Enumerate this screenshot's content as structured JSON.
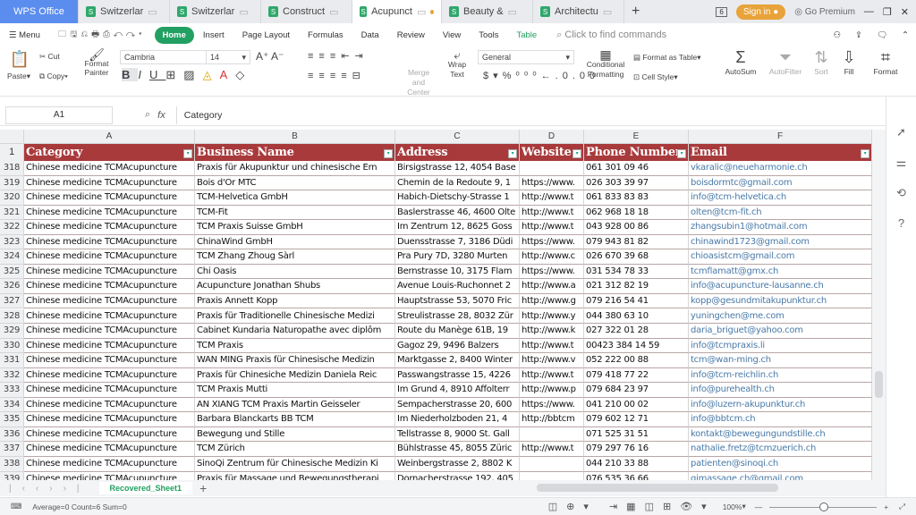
{
  "window": {
    "app": "WPS Office",
    "tabs": [
      "Switzerlar",
      "Switzerlar",
      "Construct",
      "Acupunct",
      "Beauty &",
      "Architectu"
    ],
    "active_tab": 3,
    "badge": "6",
    "sign_in": "Sign in",
    "premium": "Go Premium"
  },
  "menu": {
    "menu": "Menu",
    "items": [
      "Home",
      "Insert",
      "Page Layout",
      "Formulas",
      "Data",
      "Review",
      "View",
      "Tools",
      "Table"
    ],
    "search_placeholder": "Click to find commands"
  },
  "ribbon": {
    "cut": "Cut",
    "paste": "Paste",
    "copy": "Copy",
    "format_painter": "Format Painter",
    "font": "Cambria",
    "size": "14",
    "merge": "Merge and Center",
    "wrap": "Wrap Text",
    "number_format": "General",
    "conditional": "Conditional Formatting",
    "format_table": "Format as Table",
    "cell_style": "Cell Style",
    "autosum": "AutoSum",
    "autofilter": "AutoFilter",
    "sort": "Sort",
    "fill": "Fill",
    "format": "Format"
  },
  "formula": {
    "cell": "A1",
    "fx": "fx",
    "value": "Category"
  },
  "columns": [
    "A",
    "B",
    "C",
    "D",
    "E",
    "F"
  ],
  "headers": [
    "Category",
    "Business Name",
    "Address",
    "Website",
    "Phone Number",
    "Email"
  ],
  "rows": [
    [
      "318",
      "Chinese medicine TCMAcupuncture",
      "Praxis für Akupunktur und chinesische Ern",
      "Birsigstrasse 12, 4054 Base",
      "",
      "061 301 09 46",
      "vkaralic@neueharmonie.ch"
    ],
    [
      "319",
      "Chinese medicine TCMAcupuncture",
      "Bois d'Or MTC",
      "Chemin de la Redoute 9, 1",
      "https://www.",
      "026 303 39 97",
      "boisdormtc@gmail.com"
    ],
    [
      "320",
      "Chinese medicine TCMAcupuncture",
      "TCM-Helvetica GmbH",
      "Habich-Dietschy-Strasse 1",
      "http://www.t",
      "061 833 83 83",
      "info@tcm-helvetica.ch"
    ],
    [
      "321",
      "Chinese medicine TCMAcupuncture",
      "TCM-Fit",
      "Baslerstrasse 46, 4600 Olte",
      "http://www.t",
      "062 968 18 18",
      "olten@tcm-fit.ch"
    ],
    [
      "322",
      "Chinese medicine TCMAcupuncture",
      "TCM Praxis Suisse GmbH",
      "Im Zentrum 12, 8625 Goss",
      "http://www.t",
      "043 928 00 86",
      "zhangsubin1@hotmail.com"
    ],
    [
      "323",
      "Chinese medicine TCMAcupuncture",
      "ChinaWind GmbH",
      "Duensstrasse 7, 3186 Düdi",
      "https://www.",
      "079 943 81 82",
      "chinawind1723@gmail.com"
    ],
    [
      "324",
      "Chinese medicine TCMAcupuncture",
      "TCM Zhang Zhoug Sàrl",
      "Pra Pury 7D, 3280 Murten",
      "http://www.c",
      "026 670 39 68",
      "chioasistcm@gmail.com"
    ],
    [
      "325",
      "Chinese medicine TCMAcupuncture",
      "Chi Oasis",
      "Bernstrasse 10, 3175 Flam",
      "https://www.",
      "031 534 78 33",
      "tcmflamatt@gmx.ch"
    ],
    [
      "326",
      "Chinese medicine TCMAcupuncture",
      "Acupuncture Jonathan Shubs",
      "Avenue Louis-Ruchonnet 2",
      "http://www.a",
      "021 312 82 19",
      "info@acupuncture-lausanne.ch"
    ],
    [
      "327",
      "Chinese medicine TCMAcupuncture",
      "Praxis Annett Kopp",
      "Hauptstrasse 53, 5070 Fric",
      "http://www.g",
      "079 216 54 41",
      "kopp@gesundmitakupunktur.ch"
    ],
    [
      "328",
      "Chinese medicine TCMAcupuncture",
      "Praxis für Traditionelle Chinesische Medizi",
      "Streulistrasse 28, 8032 Zür",
      "http://www.y",
      "044 380 63 10",
      "yuningchen@me.com"
    ],
    [
      "329",
      "Chinese medicine TCMAcupuncture",
      "Cabinet Kundaria Naturopathe avec diplôm",
      "Route du Manège 61B, 19",
      "http://www.k",
      "027 322 01 28",
      "daria_briguet@yahoo.com"
    ],
    [
      "330",
      "Chinese medicine TCMAcupuncture",
      "TCM Praxis",
      "Gagoz 29, 9496 Balzers",
      "http://www.t",
      "00423 384 14 59",
      "info@tcmpraxis.li"
    ],
    [
      "331",
      "Chinese medicine TCMAcupuncture",
      "WAN MING Praxis für Chinesische Medizin",
      "Marktgasse 2, 8400 Winter",
      "http://www.v",
      "052 222 00 88",
      "tcm@wan-ming.ch"
    ],
    [
      "332",
      "Chinese medicine TCMAcupuncture",
      "Praxis für Chinesiche Medizin Daniela Reic",
      "Passwangstrasse 15, 4226",
      "http://www.t",
      "079 418 77 22",
      "info@tcm-reichlin.ch"
    ],
    [
      "333",
      "Chinese medicine TCMAcupuncture",
      "TCM Praxis Mutti",
      "Im Grund 4, 8910 Affolterr",
      "http://www.p",
      "079 684 23 97",
      "info@purehealth.ch"
    ],
    [
      "334",
      "Chinese medicine TCMAcupuncture",
      "AN XIANG TCM Praxis Martin Geisseler",
      "Sempacherstrasse 20, 600",
      "https://www.",
      "041 210 00 02",
      "info@luzern-akupunktur.ch"
    ],
    [
      "335",
      "Chinese medicine TCMAcupuncture",
      "Barbara Blanckarts BB TCM",
      "Im Niederholzboden 21, 4",
      "http://bbtcm",
      "079 602 12 71",
      "info@bbtcm.ch"
    ],
    [
      "336",
      "Chinese medicine TCMAcupuncture",
      "Bewegung und Stille",
      "Tellstrasse 8, 9000 St. Gall",
      "",
      "071 525 31 51",
      "kontakt@bewegungundstille.ch"
    ],
    [
      "337",
      "Chinese medicine TCMAcupuncture",
      "TCM Zürich",
      "Bühlstrasse 45, 8055 Züric",
      "http://www.t",
      "079 297 76 16",
      "nathalie.fretz@tcmzuerich.ch"
    ],
    [
      "338",
      "Chinese medicine TCMAcupuncture",
      "SinoQi Zentrum für Chinesische Medizin Ki",
      "Weinbergstrasse 2, 8802 K",
      "",
      "044 210 33 88",
      "patienten@sinoqi.ch"
    ],
    [
      "339",
      "Chinese medicine TCMAcupuncture",
      "Praxis für Massage und Bewegungstherapi",
      "Dornacherstrasse 192, 405",
      "",
      "076 535 36 66",
      "qimassage.ch@gmail.com"
    ]
  ],
  "sheet": {
    "name": "Recovered_Sheet1"
  },
  "status": {
    "summary": "Average=0  Count=6  Sum=0",
    "zoom": "100%",
    "zoom_level": 100
  },
  "colors": {
    "header_fill": "#a83a3c",
    "accent": "#22a061",
    "email_text": "#4a7aa8",
    "sign_in": "#e8a33a"
  }
}
